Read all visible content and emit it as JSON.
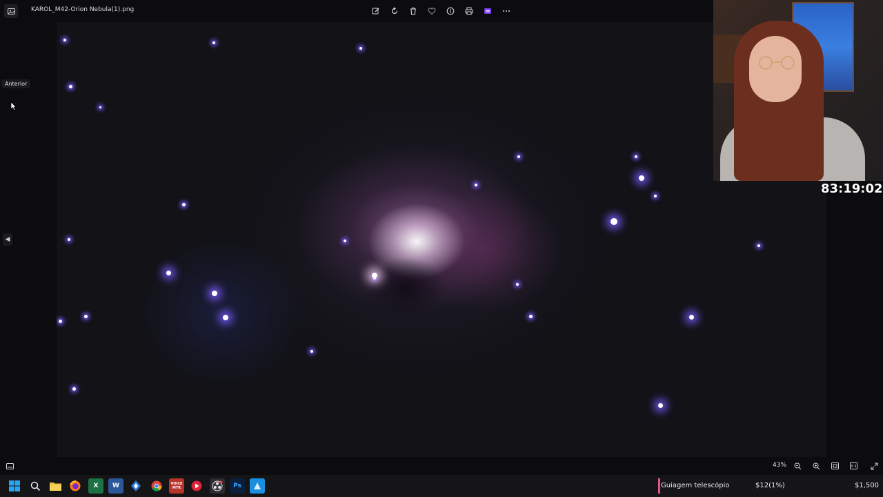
{
  "window": {
    "filename": "KAROL_M42-Orion Nebula(1).png"
  },
  "toolbar": {
    "icons": [
      "edit-icon",
      "rotate-icon",
      "delete-icon",
      "favorite-icon",
      "info-icon",
      "print-icon",
      "clipchamp-icon",
      "more-icon"
    ]
  },
  "viewer": {
    "tooltip": "Anterior",
    "zoom_level": "43%"
  },
  "stream": {
    "timer": "83:19:02",
    "goal_label": "Guiagem telescópio",
    "goal_progress": "$12(1%)",
    "goal_target": "$1,500",
    "goal_fraction": 0.01
  },
  "taskbar": {
    "apps": [
      "windows-start",
      "search",
      "file-explorer",
      "firefox",
      "excel",
      "word",
      "sourcetree",
      "chrome",
      "voicemeeter",
      "media-player",
      "obs",
      "photoshop",
      "app-blue"
    ],
    "voicemeeter_label": "VOICE MTR",
    "photoshop_label": "Ps"
  },
  "colors": {
    "accent_purple": "#7a5cff",
    "goal_bar": "#e0558a"
  }
}
